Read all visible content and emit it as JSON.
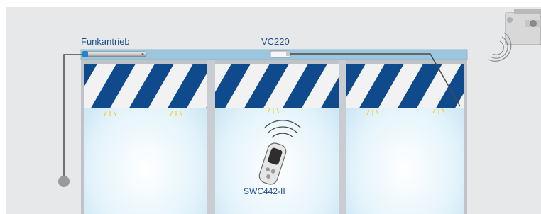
{
  "labels": {
    "motor": "Funkantrieb",
    "receiver": "VC220",
    "remote": "SWC442-II"
  },
  "colors": {
    "wall": "#e7e8ea",
    "rail": "#9cc6dd",
    "stripe_blue": "#0e4a8c",
    "stripe_white": "#f2f2f2",
    "frame": "#bfc3c7",
    "glass": "#d3ecf6",
    "label": "#1e4e8c",
    "lamp": "#f1d23a"
  },
  "icons": {
    "sensor": "weather-sensor-icon",
    "motor": "tubular-motor-icon",
    "receiver": "receiver-box-icon",
    "remote": "remote-control-icon",
    "signal": "radio-waves-icon",
    "cable_end": "cable-end-dot-icon"
  }
}
